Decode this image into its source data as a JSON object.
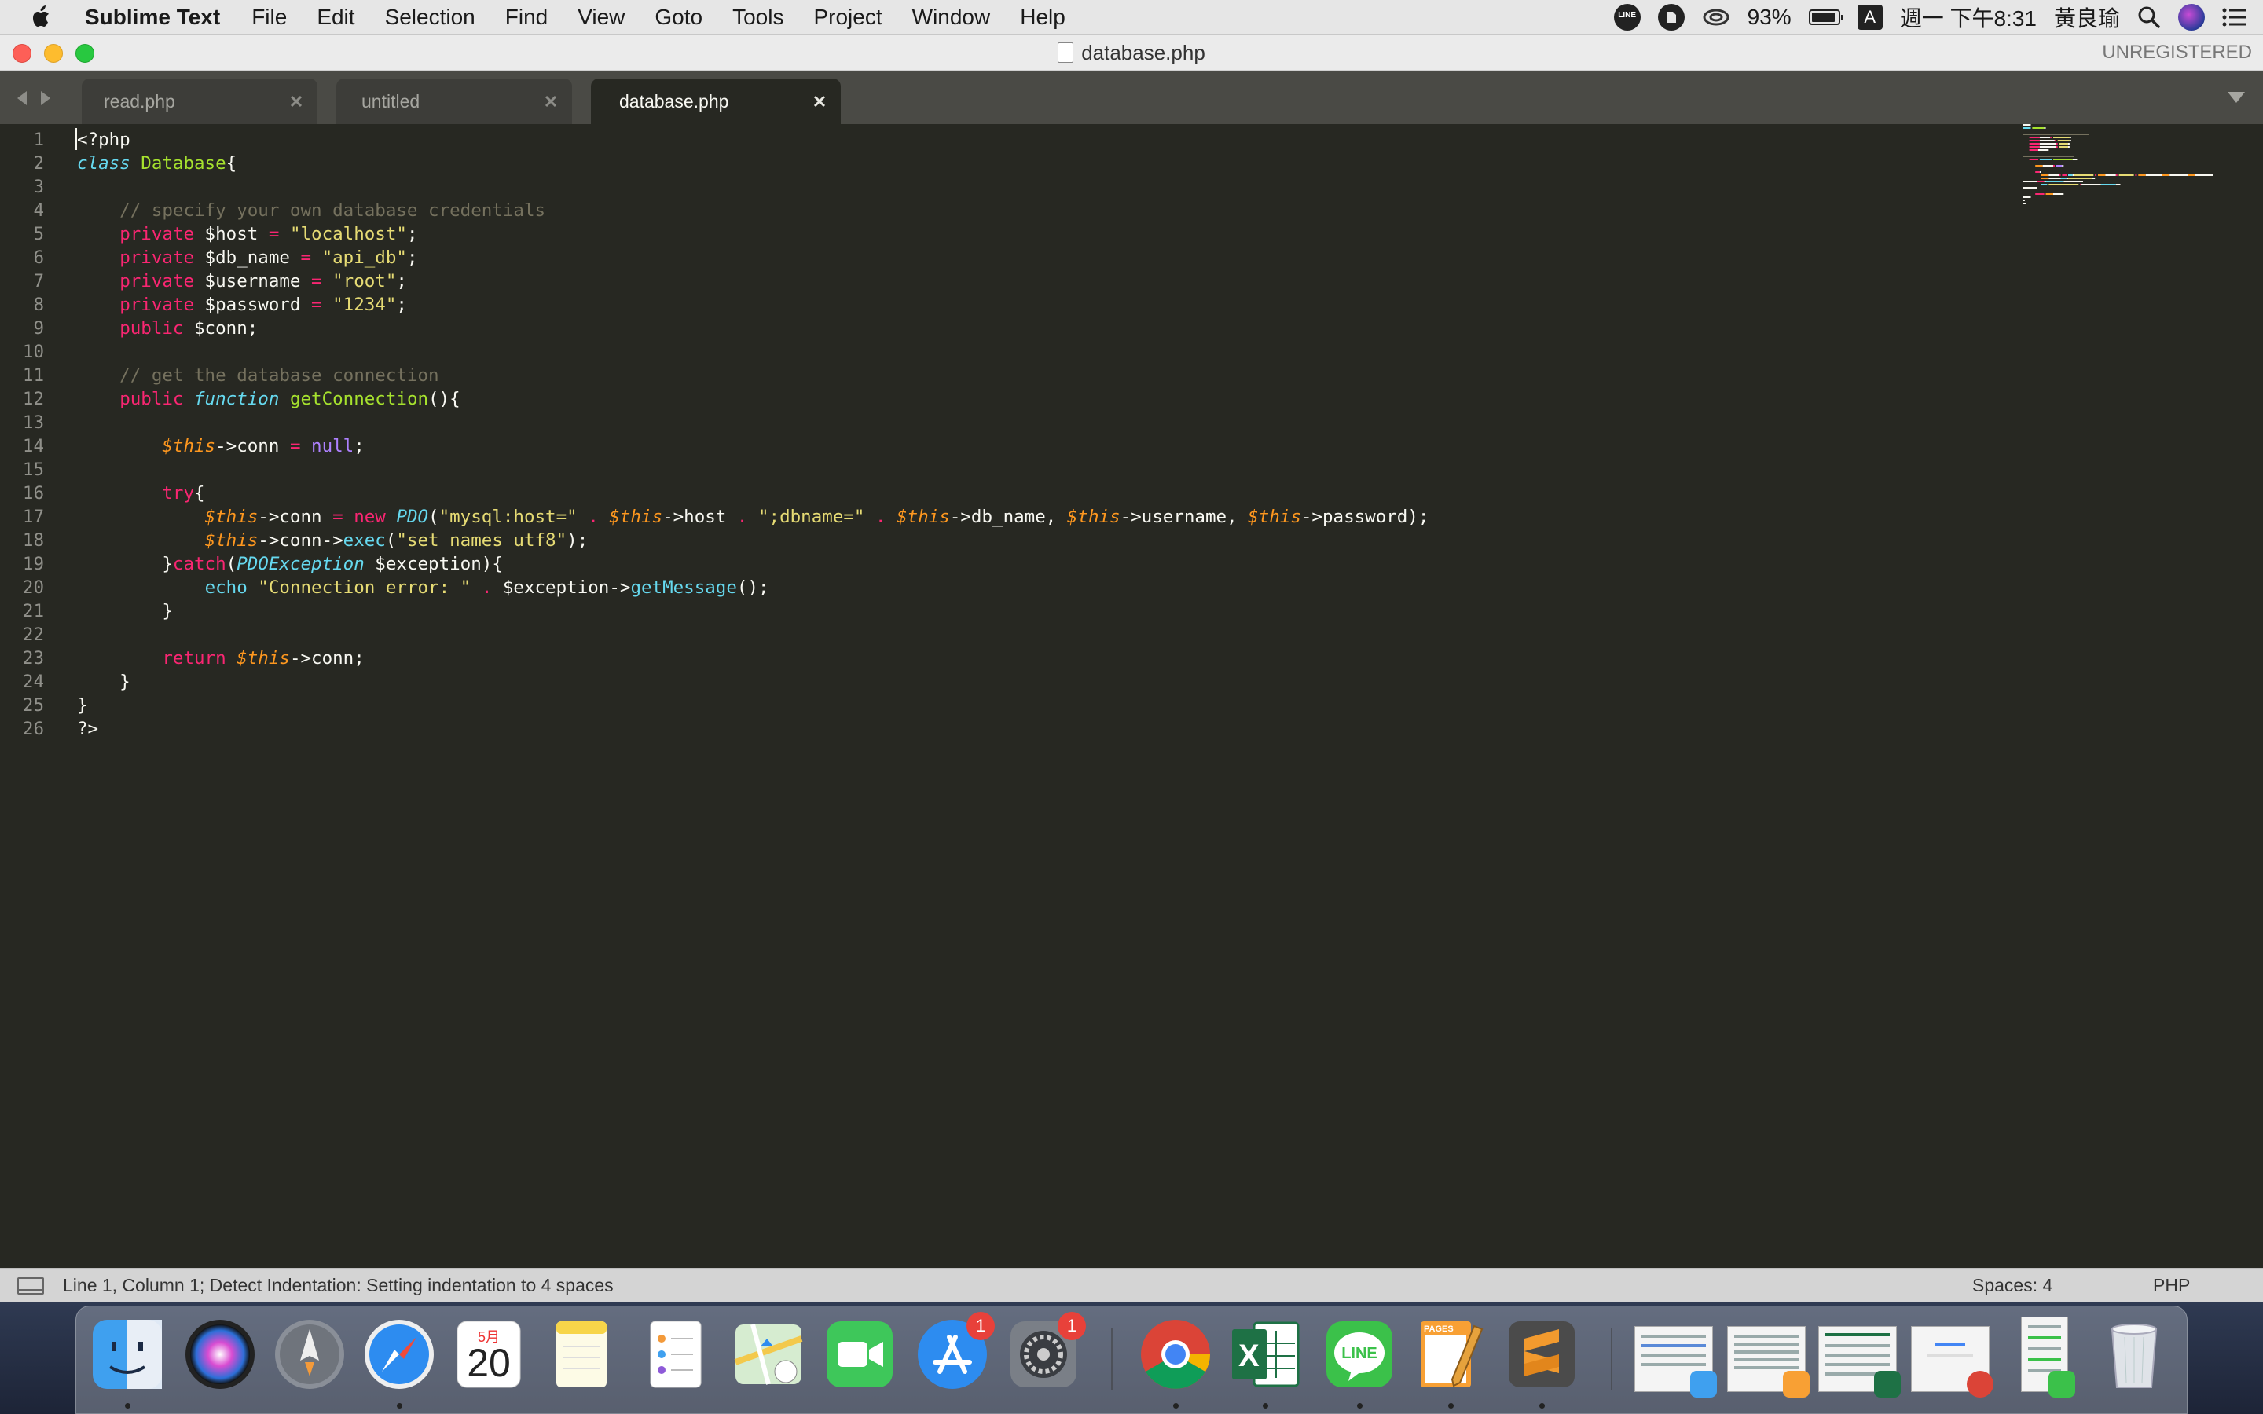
{
  "menubar": {
    "app_name": "Sublime Text",
    "menus": [
      "File",
      "Edit",
      "Selection",
      "Find",
      "View",
      "Goto",
      "Tools",
      "Project",
      "Window",
      "Help"
    ],
    "status": {
      "line_icon_text": "LINE",
      "battery": "93%",
      "battery_level": 0.93,
      "ime": "A",
      "datetime": "週一 下午8:31",
      "user": "黃良瑜"
    }
  },
  "window": {
    "title": "database.php",
    "license": "UNREGISTERED"
  },
  "tabs": [
    {
      "label": "read.php",
      "active": false
    },
    {
      "label": "untitled",
      "active": false
    },
    {
      "label": "database.php",
      "active": true
    }
  ],
  "editor": {
    "line_numbers": [
      "1",
      "2",
      "3",
      "4",
      "5",
      "6",
      "7",
      "8",
      "9",
      "10",
      "11",
      "12",
      "13",
      "14",
      "15",
      "16",
      "17",
      "18",
      "19",
      "20",
      "21",
      "22",
      "23",
      "24",
      "25",
      "26"
    ],
    "theme_colors": {
      "background": "#272822",
      "keyword": "#f92672",
      "storage": "#66d9ef",
      "class_name": "#a6e22e",
      "string": "#e6db74",
      "comment": "#75715e",
      "variable": "#fd971f",
      "constant": "#ae81ff",
      "text": "#f8f8f2"
    },
    "lines": [
      [
        {
          "t": "<?php",
          "c": "text"
        }
      ],
      [
        {
          "t": "class",
          "c": "storage_i"
        },
        {
          "t": " ",
          "c": "text"
        },
        {
          "t": "Database",
          "c": "class_name"
        },
        {
          "t": "{",
          "c": "text"
        }
      ],
      [],
      [
        {
          "t": "    // specify your own database credentials",
          "c": "comment"
        }
      ],
      [
        {
          "t": "    ",
          "c": "text"
        },
        {
          "t": "private",
          "c": "keyword"
        },
        {
          "t": " $host ",
          "c": "text"
        },
        {
          "t": "=",
          "c": "keyword"
        },
        {
          "t": " ",
          "c": "text"
        },
        {
          "t": "\"localhost\"",
          "c": "string"
        },
        {
          "t": ";",
          "c": "text"
        }
      ],
      [
        {
          "t": "    ",
          "c": "text"
        },
        {
          "t": "private",
          "c": "keyword"
        },
        {
          "t": " $db_name ",
          "c": "text"
        },
        {
          "t": "=",
          "c": "keyword"
        },
        {
          "t": " ",
          "c": "text"
        },
        {
          "t": "\"api_db\"",
          "c": "string"
        },
        {
          "t": ";",
          "c": "text"
        }
      ],
      [
        {
          "t": "    ",
          "c": "text"
        },
        {
          "t": "private",
          "c": "keyword"
        },
        {
          "t": " $username ",
          "c": "text"
        },
        {
          "t": "=",
          "c": "keyword"
        },
        {
          "t": " ",
          "c": "text"
        },
        {
          "t": "\"root\"",
          "c": "string"
        },
        {
          "t": ";",
          "c": "text"
        }
      ],
      [
        {
          "t": "    ",
          "c": "text"
        },
        {
          "t": "private",
          "c": "keyword"
        },
        {
          "t": " $password ",
          "c": "text"
        },
        {
          "t": "=",
          "c": "keyword"
        },
        {
          "t": " ",
          "c": "text"
        },
        {
          "t": "\"1234\"",
          "c": "string"
        },
        {
          "t": ";",
          "c": "text"
        }
      ],
      [
        {
          "t": "    ",
          "c": "text"
        },
        {
          "t": "public",
          "c": "keyword"
        },
        {
          "t": " $conn;",
          "c": "text"
        }
      ],
      [],
      [
        {
          "t": "    // get the database connection",
          "c": "comment"
        }
      ],
      [
        {
          "t": "    ",
          "c": "text"
        },
        {
          "t": "public",
          "c": "keyword"
        },
        {
          "t": " ",
          "c": "text"
        },
        {
          "t": "function",
          "c": "storage_i"
        },
        {
          "t": " ",
          "c": "text"
        },
        {
          "t": "getConnection",
          "c": "class_name"
        },
        {
          "t": "(){",
          "c": "text"
        }
      ],
      [],
      [
        {
          "t": "        ",
          "c": "text"
        },
        {
          "t": "$this",
          "c": "variable_i"
        },
        {
          "t": "->conn ",
          "c": "text"
        },
        {
          "t": "=",
          "c": "keyword"
        },
        {
          "t": " ",
          "c": "text"
        },
        {
          "t": "null",
          "c": "constant"
        },
        {
          "t": ";",
          "c": "text"
        }
      ],
      [],
      [
        {
          "t": "        ",
          "c": "text"
        },
        {
          "t": "try",
          "c": "keyword"
        },
        {
          "t": "{",
          "c": "text"
        }
      ],
      [
        {
          "t": "            ",
          "c": "text"
        },
        {
          "t": "$this",
          "c": "variable_i"
        },
        {
          "t": "->conn ",
          "c": "text"
        },
        {
          "t": "=",
          "c": "keyword"
        },
        {
          "t": " ",
          "c": "text"
        },
        {
          "t": "new",
          "c": "keyword"
        },
        {
          "t": " ",
          "c": "text"
        },
        {
          "t": "PDO",
          "c": "storage_i"
        },
        {
          "t": "(",
          "c": "text"
        },
        {
          "t": "\"mysql:host=\"",
          "c": "string"
        },
        {
          "t": " ",
          "c": "text"
        },
        {
          "t": ".",
          "c": "keyword"
        },
        {
          "t": " ",
          "c": "text"
        },
        {
          "t": "$this",
          "c": "variable_i"
        },
        {
          "t": "->host ",
          "c": "text"
        },
        {
          "t": ".",
          "c": "keyword"
        },
        {
          "t": " ",
          "c": "text"
        },
        {
          "t": "\";dbname=\"",
          "c": "string"
        },
        {
          "t": " ",
          "c": "text"
        },
        {
          "t": ".",
          "c": "keyword"
        },
        {
          "t": " ",
          "c": "text"
        },
        {
          "t": "$this",
          "c": "variable_i"
        },
        {
          "t": "->db_name, ",
          "c": "text"
        },
        {
          "t": "$this",
          "c": "variable_i"
        },
        {
          "t": "->username, ",
          "c": "text"
        },
        {
          "t": "$this",
          "c": "variable_i"
        },
        {
          "t": "->password);",
          "c": "text"
        }
      ],
      [
        {
          "t": "            ",
          "c": "text"
        },
        {
          "t": "$this",
          "c": "variable_i"
        },
        {
          "t": "->conn->",
          "c": "text"
        },
        {
          "t": "exec",
          "c": "storage"
        },
        {
          "t": "(",
          "c": "text"
        },
        {
          "t": "\"set names utf8\"",
          "c": "string"
        },
        {
          "t": ");",
          "c": "text"
        }
      ],
      [
        {
          "t": "        }",
          "c": "text"
        },
        {
          "t": "catch",
          "c": "keyword"
        },
        {
          "t": "(",
          "c": "text"
        },
        {
          "t": "PDOException",
          "c": "storage_i"
        },
        {
          "t": " $exception){",
          "c": "text"
        }
      ],
      [
        {
          "t": "            ",
          "c": "text"
        },
        {
          "t": "echo",
          "c": "storage"
        },
        {
          "t": " ",
          "c": "text"
        },
        {
          "t": "\"Connection error: \"",
          "c": "string"
        },
        {
          "t": " ",
          "c": "text"
        },
        {
          "t": ".",
          "c": "keyword"
        },
        {
          "t": " $exception->",
          "c": "text"
        },
        {
          "t": "getMessage",
          "c": "storage"
        },
        {
          "t": "();",
          "c": "text"
        }
      ],
      [
        {
          "t": "        }",
          "c": "text"
        }
      ],
      [],
      [
        {
          "t": "        ",
          "c": "text"
        },
        {
          "t": "return",
          "c": "keyword"
        },
        {
          "t": " ",
          "c": "text"
        },
        {
          "t": "$this",
          "c": "variable_i"
        },
        {
          "t": "->conn;",
          "c": "text"
        }
      ],
      [
        {
          "t": "    }",
          "c": "text"
        }
      ],
      [
        {
          "t": "}",
          "c": "text"
        }
      ],
      [
        {
          "t": "?>",
          "c": "text"
        }
      ]
    ]
  },
  "statusbar": {
    "message": "Line 1, Column 1; Detect Indentation: Setting indentation to 4 spaces",
    "indentation": "Spaces: 4",
    "syntax": "PHP"
  },
  "dock": {
    "calendar_month": "5月",
    "calendar_day": "20",
    "appstore_badge": "1",
    "settings_badge": "1",
    "line_label": "LINE",
    "pages_label": "PAGES",
    "excel_letter": "X"
  }
}
